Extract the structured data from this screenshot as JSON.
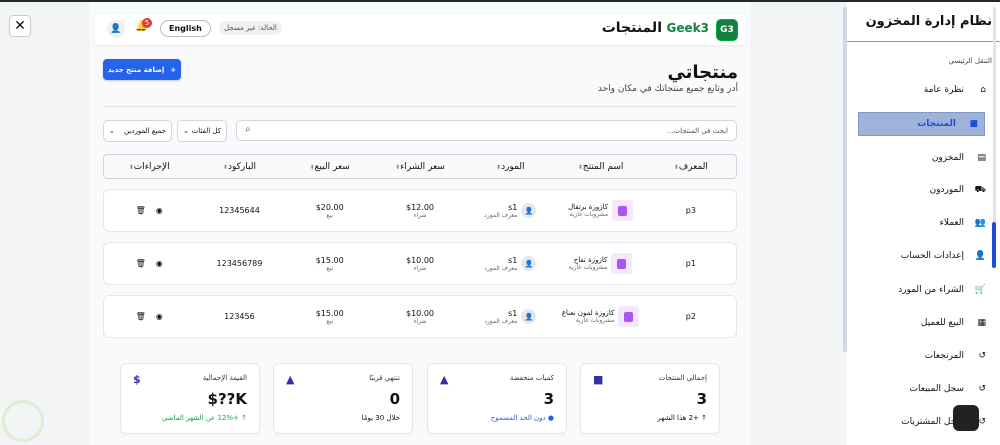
{
  "header": {
    "logo": "G3",
    "brand": "Geek3",
    "title": "المنتجات",
    "status": "الحالة: غير مسجل",
    "language": "English",
    "notifications": "5"
  },
  "page": {
    "title": "منتجاتي",
    "subtitle": "أدر وتابع جميع منتجاتك في مكان واحد",
    "add_button": "إضافة منتج جديد"
  },
  "filters": {
    "search_placeholder": "ابحث في المنتجات...",
    "category": "كل الفئات",
    "supplier": "جميع الموردين"
  },
  "table": {
    "headers": [
      "المعرف",
      "اسم المنتج",
      "المورد",
      "سعر الشراء",
      "سعر البيع",
      "الباركود",
      "الإجراءات"
    ],
    "rows": [
      {
        "id": "p3",
        "name": "كازوزة برتقال",
        "category": "مشروبات غازية",
        "supplier": "s1",
        "supplier_label": "معرف المورد",
        "buy": "$12.00",
        "buy_label": "شراء",
        "sell": "$20.00",
        "sell_label": "بيع",
        "barcode": "12345644"
      },
      {
        "id": "p1",
        "name": "كازوزة تفاح",
        "category": "مشروبات غازية",
        "supplier": "s1",
        "supplier_label": "معرف المورد",
        "buy": "$10.00",
        "buy_label": "شراء",
        "sell": "$15.00",
        "sell_label": "بيع",
        "barcode": "123456789"
      },
      {
        "id": "p2",
        "name": "كازوزة لمون نعناع",
        "category": "مشروبات غازية",
        "supplier": "s1",
        "supplier_label": "معرف المورد",
        "buy": "$10.00",
        "buy_label": "شراء",
        "sell": "$15.00",
        "sell_label": "بيع",
        "barcode": "123456"
      }
    ]
  },
  "stats": [
    {
      "title": "إجمالي المنتجات",
      "value": "3",
      "note": "↑ +2 هذا الشهر",
      "color": "#111111"
    },
    {
      "title": "كميات منخفضة",
      "value": "3",
      "note": "● دون الحد المسموح",
      "color": "#2563eb"
    },
    {
      "title": "تنتهي قريبًا",
      "value": "0",
      "note": "خلال 30 يومًا",
      "color": "#111111"
    },
    {
      "title": "القيمة الإجمالية",
      "value": "K??$",
      "note": "↑ +12% عن الشهر الماضي",
      "color": "#16a34a"
    }
  ],
  "sidebar": {
    "title": "نظام إدارة المخزون",
    "section": "التنقل الرئيسي",
    "items": [
      {
        "label": "نظرة عامة",
        "icon": "⌂"
      },
      {
        "label": "المنتجات",
        "icon": "■"
      },
      {
        "label": "المخزون",
        "icon": "▤"
      },
      {
        "label": "الموردون",
        "icon": "⛟"
      },
      {
        "label": "العملاء",
        "icon": "👥"
      },
      {
        "label": "إعدادات الحساب",
        "icon": "👤"
      },
      {
        "label": "الشراء من المورد",
        "icon": "🛒"
      },
      {
        "label": "البيع للعميل",
        "icon": "▦"
      },
      {
        "label": "المرتجعات",
        "icon": "↺"
      },
      {
        "label": "سجل المبيعات",
        "icon": "↺"
      },
      {
        "label": "سجل المشتريات",
        "icon": "↺"
      }
    ]
  }
}
